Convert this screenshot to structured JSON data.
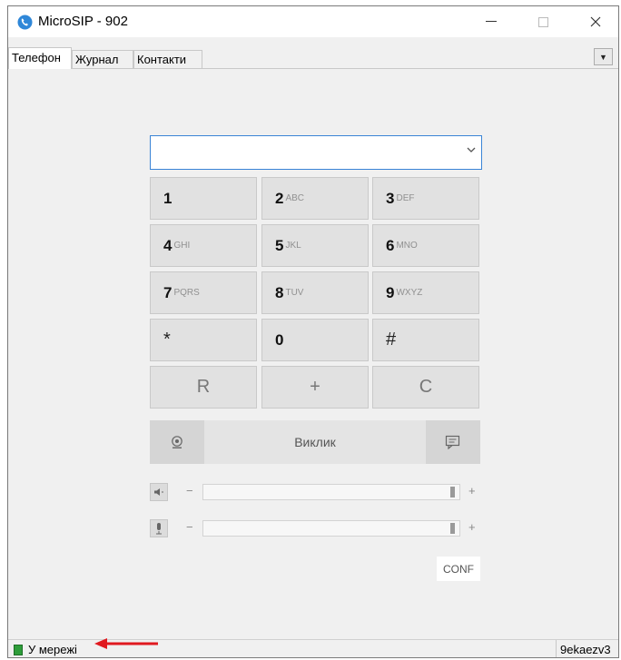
{
  "window": {
    "title": "MicroSIP - 902"
  },
  "title_buttons": {
    "minimize": "—",
    "maximize": "☐",
    "close": "✕"
  },
  "tabs": [
    {
      "label": "Телефон",
      "active": true
    },
    {
      "label": "Журнал",
      "active": false
    },
    {
      "label": "Контакти",
      "active": false
    }
  ],
  "menu_dropdown": {
    "icon": "dropdown-triangle-icon",
    "glyph": "▼"
  },
  "dial_input": {
    "value": "",
    "placeholder": ""
  },
  "keypad": {
    "keys": [
      {
        "digit": "1",
        "letters": ""
      },
      {
        "digit": "2",
        "letters": "ABC"
      },
      {
        "digit": "3",
        "letters": "DEF"
      },
      {
        "digit": "4",
        "letters": "GHI"
      },
      {
        "digit": "5",
        "letters": "JKL"
      },
      {
        "digit": "6",
        "letters": "MNO"
      },
      {
        "digit": "7",
        "letters": "PQRS"
      },
      {
        "digit": "8",
        "letters": "TUV"
      },
      {
        "digit": "9",
        "letters": "WXYZ"
      },
      {
        "digit": "*",
        "letters": ""
      },
      {
        "digit": "0",
        "letters": ""
      },
      {
        "digit": "#",
        "letters": ""
      }
    ],
    "ops": [
      "R",
      "+",
      "C"
    ]
  },
  "call": {
    "label": "Виклик",
    "left_icon": "video-call-icon",
    "right_icon": "message-icon"
  },
  "speaker": {
    "icon": "speaker-icon",
    "minus": "−",
    "plus": "+",
    "level": 1.0
  },
  "microphone": {
    "icon": "microphone-icon",
    "minus": "−",
    "plus": "+",
    "level": 1.0
  },
  "conf_label": "CONF",
  "status": {
    "text": "У мережі",
    "account": "9ekaezv3",
    "color": "#2e9d3a"
  },
  "colors": {
    "accent": "#3a84d6",
    "annotation": "#e0191f"
  }
}
